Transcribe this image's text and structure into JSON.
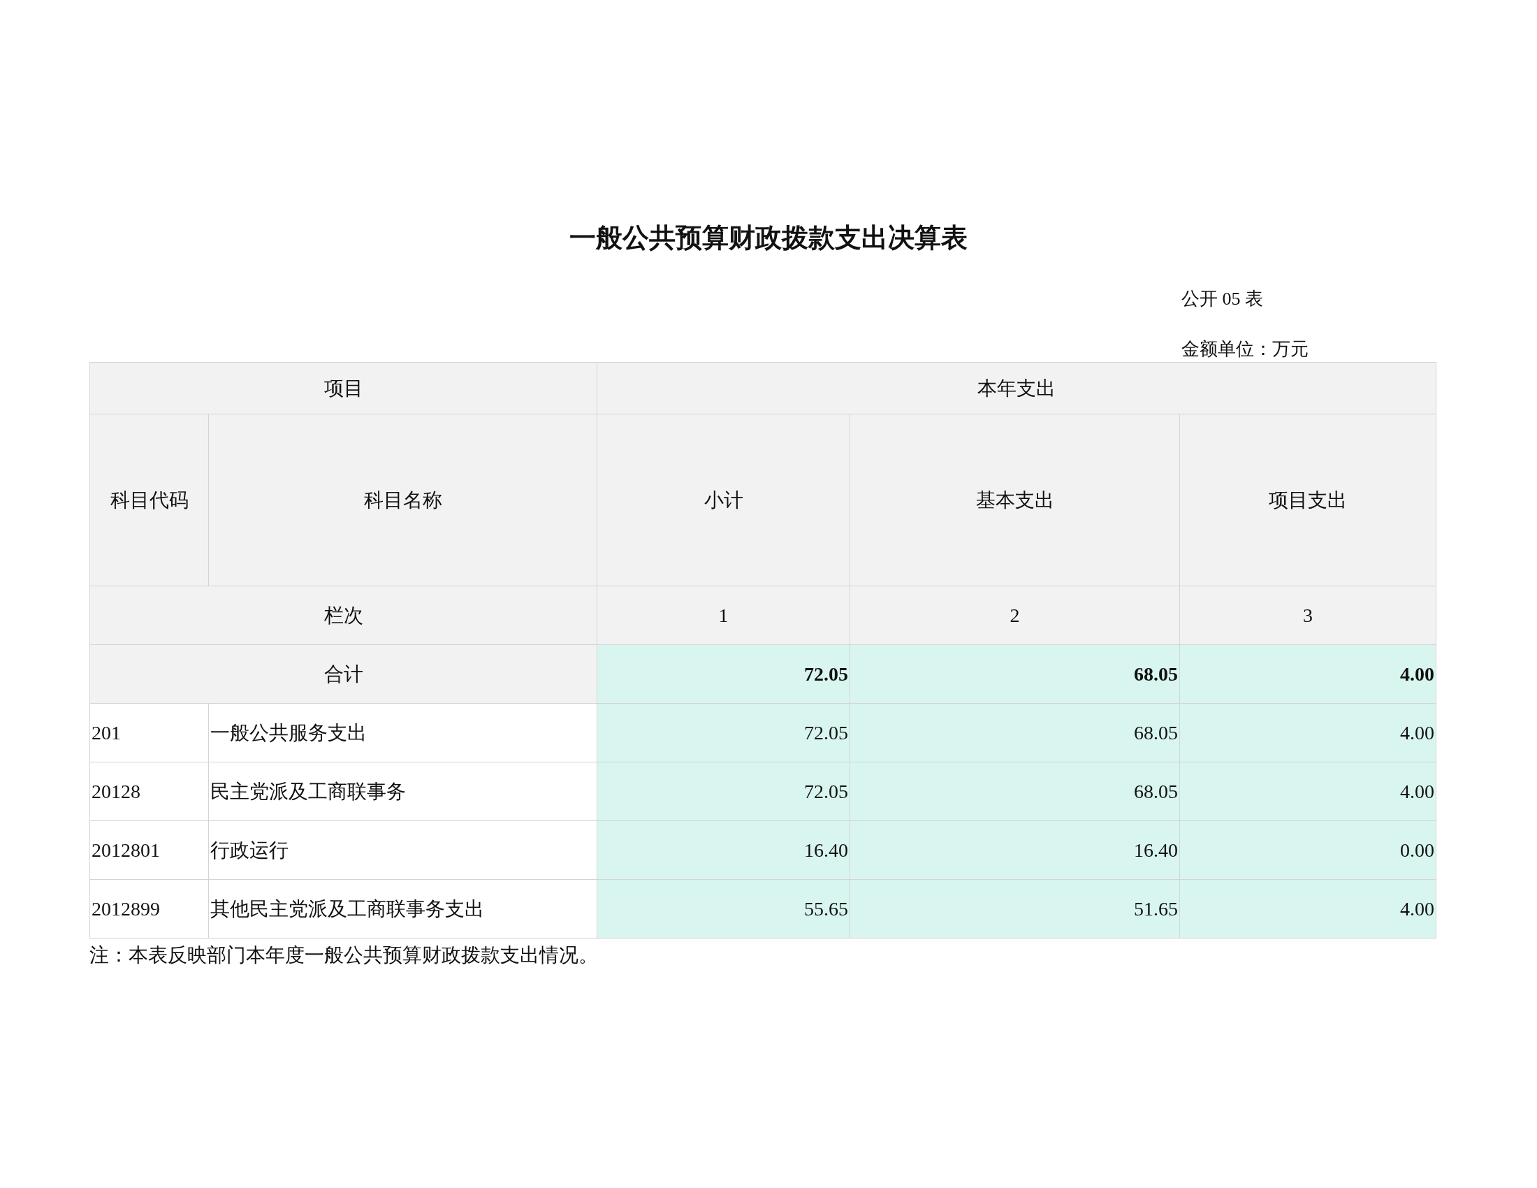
{
  "title": "一般公共预算财政拨款支出决算表",
  "table_number": "公开 05 表",
  "unit": "金额单位：万元",
  "header": {
    "group_left": "项目",
    "group_right": "本年支出",
    "code": "科目代码",
    "name": "科目名称",
    "columns": [
      "小计",
      "基本支出",
      "项目支出"
    ]
  },
  "index_row": {
    "label": "栏次",
    "values": [
      "1",
      "2",
      "3"
    ]
  },
  "total_row": {
    "label": "合计",
    "values": [
      "72.05",
      "68.05",
      "4.00"
    ]
  },
  "rows": [
    {
      "code": "201",
      "name": "一般公共服务支出",
      "values": [
        "72.05",
        "68.05",
        "4.00"
      ]
    },
    {
      "code": "20128",
      "name": "民主党派及工商联事务",
      "values": [
        "72.05",
        "68.05",
        "4.00"
      ]
    },
    {
      "code": "2012801",
      "name": "行政运行",
      "values": [
        "16.40",
        "16.40",
        "0.00"
      ]
    },
    {
      "code": "2012899",
      "name": "其他民主党派及工商联事务支出",
      "values": [
        "55.65",
        "51.65",
        "4.00"
      ]
    }
  ],
  "note": "注：本表反映部门本年度一般公共预算财政拨款支出情况。"
}
